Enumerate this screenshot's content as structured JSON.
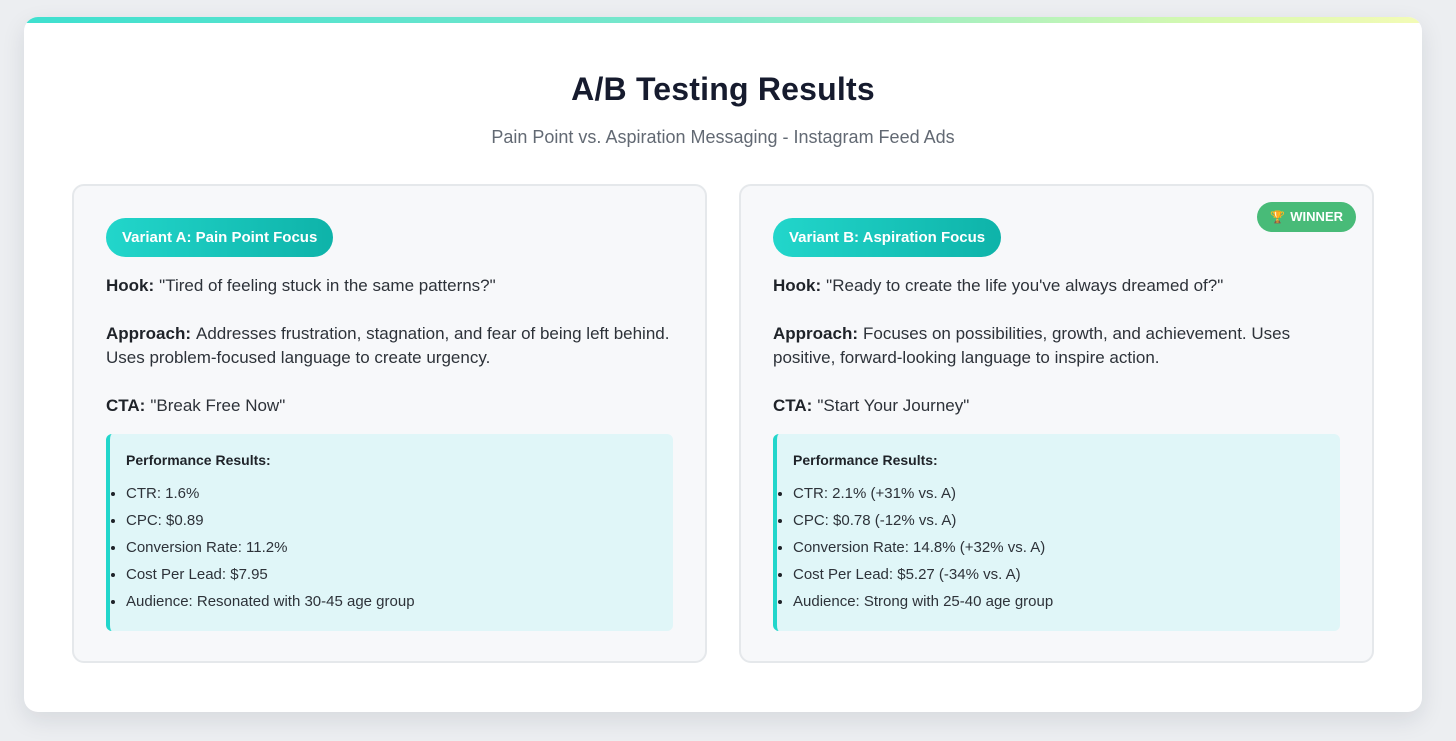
{
  "header": {
    "title": "A/B Testing Results",
    "subtitle": "Pain Point vs. Aspiration Messaging - Instagram Feed Ads"
  },
  "colors": {
    "accent_teal": "#22d6cb",
    "winner_green": "#48bb78",
    "perf_bg": "#e0f6f8"
  },
  "variant_a": {
    "label": "Variant A: Pain Point Focus",
    "hook_label": "Hook:",
    "hook": "\"Tired of feeling stuck in the same patterns?\"",
    "approach_label": "Approach:",
    "approach": "Addresses frustration, stagnation, and fear of being left behind. Uses problem-focused language to create urgency.",
    "cta_label": "CTA:",
    "cta": "\"Break Free Now\"",
    "perf_title": "Performance Results:",
    "results": [
      "CTR: 1.6%",
      "CPC: $0.89",
      "Conversion Rate: 11.2%",
      "Cost Per Lead: $7.95",
      "Audience: Resonated with 30-45 age group"
    ]
  },
  "variant_b": {
    "label": "Variant B: Aspiration Focus",
    "badge_icon": "trophy-icon",
    "badge": "WINNER",
    "hook_label": "Hook:",
    "hook": "\"Ready to create the life you've always dreamed of?\"",
    "approach_label": "Approach:",
    "approach": "Focuses on possibilities, growth, and achievement. Uses positive, forward-looking language to inspire action.",
    "cta_label": "CTA:",
    "cta": "\"Start Your Journey\"",
    "perf_title": "Performance Results:",
    "results": [
      "CTR: 2.1% (+31% vs. A)",
      "CPC: $0.78 (-12% vs. A)",
      "Conversion Rate: 14.8% (+32% vs. A)",
      "Cost Per Lead: $5.27 (-34% vs. A)",
      "Audience: Strong with 25-40 age group"
    ]
  }
}
